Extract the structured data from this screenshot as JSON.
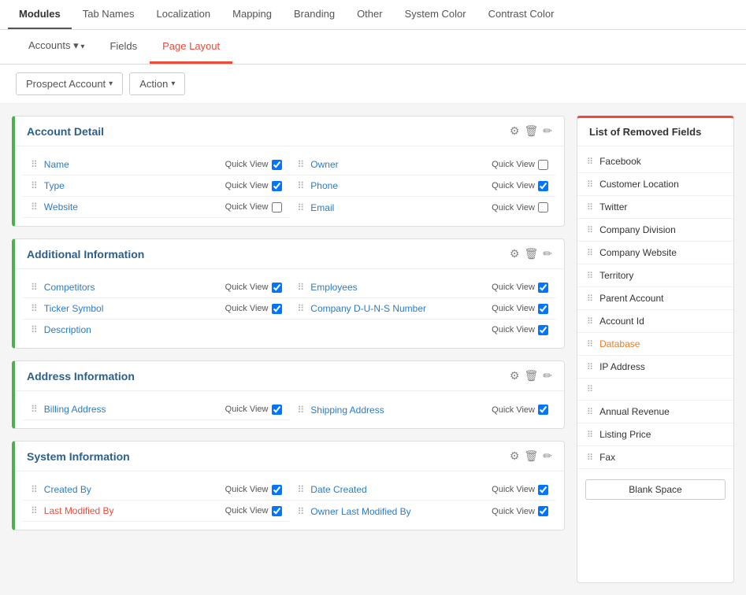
{
  "topNav": {
    "tabs": [
      {
        "id": "modules",
        "label": "Modules",
        "active": true
      },
      {
        "id": "tab-names",
        "label": "Tab Names",
        "active": false
      },
      {
        "id": "localization",
        "label": "Localization",
        "active": false
      },
      {
        "id": "mapping",
        "label": "Mapping",
        "active": false
      },
      {
        "id": "branding",
        "label": "Branding",
        "active": false
      },
      {
        "id": "other",
        "label": "Other",
        "active": false
      },
      {
        "id": "system-color",
        "label": "System Color",
        "active": false
      },
      {
        "id": "contrast-color",
        "label": "Contrast Color",
        "active": false
      }
    ]
  },
  "subNav": {
    "tabs": [
      {
        "id": "accounts",
        "label": "Accounts",
        "active": false,
        "hasArrow": true
      },
      {
        "id": "fields",
        "label": "Fields",
        "active": false,
        "hasArrow": false
      },
      {
        "id": "page-layout",
        "label": "Page Layout",
        "active": true,
        "hasArrow": false
      }
    ]
  },
  "toolbar": {
    "accountDropdown": "Prospect Account",
    "actionDropdown": "Action"
  },
  "sections": [
    {
      "id": "account-detail",
      "title": "Account Detail",
      "fields": [
        {
          "col": 0,
          "name": "Name",
          "isRed": false,
          "quickViewLabel": "Quick View",
          "checked": true
        },
        {
          "col": 1,
          "name": "Owner",
          "isRed": false,
          "quickViewLabel": "Quick View",
          "checked": false
        },
        {
          "col": 0,
          "name": "Type",
          "isRed": false,
          "quickViewLabel": "Quick View",
          "checked": true
        },
        {
          "col": 1,
          "name": "Phone",
          "isRed": false,
          "quickViewLabel": "Quick View",
          "checked": true
        },
        {
          "col": 0,
          "name": "Website",
          "isRed": false,
          "quickViewLabel": "Quick View",
          "checked": false
        },
        {
          "col": 1,
          "name": "Email",
          "isRed": false,
          "quickViewLabel": "Quick View",
          "checked": false
        }
      ]
    },
    {
      "id": "additional-information",
      "title": "Additional Information",
      "fields": [
        {
          "col": 0,
          "name": "Competitors",
          "isRed": false,
          "quickViewLabel": "Quick View",
          "checked": true
        },
        {
          "col": 1,
          "name": "Employees",
          "isRed": false,
          "quickViewLabel": "Quick View",
          "checked": true
        },
        {
          "col": 0,
          "name": "Ticker Symbol",
          "isRed": false,
          "quickViewLabel": "Quick View",
          "checked": true
        },
        {
          "col": 1,
          "name": "Company D-U-N-S Number",
          "isRed": false,
          "quickViewLabel": "Quick View",
          "checked": true
        },
        {
          "col": 0,
          "name": "Description",
          "isRed": false,
          "quickViewLabel": "Quick View",
          "checked": true,
          "fullWidth": true
        }
      ]
    },
    {
      "id": "address-information",
      "title": "Address Information",
      "fields": [
        {
          "col": 0,
          "name": "Billing Address",
          "isRed": false,
          "quickViewLabel": "Quick View",
          "checked": true
        },
        {
          "col": 1,
          "name": "Shipping Address",
          "isRed": false,
          "quickViewLabel": "Quick View",
          "checked": true
        }
      ]
    },
    {
      "id": "system-information",
      "title": "System Information",
      "fields": [
        {
          "col": 0,
          "name": "Created By",
          "isRed": false,
          "quickViewLabel": "Quick View",
          "checked": true
        },
        {
          "col": 1,
          "name": "Date Created",
          "isRed": false,
          "quickViewLabel": "Quick View",
          "checked": true
        },
        {
          "col": 0,
          "name": "Last Modified By",
          "isRed": true,
          "quickViewLabel": "Quick View",
          "checked": true
        },
        {
          "col": 1,
          "name": "Owner Last Modified By",
          "isRed": false,
          "quickViewLabel": "Quick View",
          "checked": true
        }
      ]
    }
  ],
  "removedFields": {
    "title": "List of Removed Fields",
    "items": [
      {
        "name": "Facebook",
        "isOrange": false
      },
      {
        "name": "Customer Location",
        "isOrange": false
      },
      {
        "name": "Twitter",
        "isOrange": false
      },
      {
        "name": "Company Division",
        "isOrange": false
      },
      {
        "name": "Company Website",
        "isOrange": false
      },
      {
        "name": "Territory",
        "isOrange": false
      },
      {
        "name": "Parent Account",
        "isOrange": false
      },
      {
        "name": "Account Id",
        "isOrange": false
      },
      {
        "name": "Database",
        "isOrange": true
      },
      {
        "name": "IP Address",
        "isOrange": false
      },
      {
        "name": "",
        "isOrange": false
      },
      {
        "name": "Annual Revenue",
        "isOrange": false
      },
      {
        "name": "Listing Price",
        "isOrange": false
      },
      {
        "name": "Fax",
        "isOrange": false
      }
    ],
    "blankSpaceLabel": "Blank Space"
  },
  "icons": {
    "gear": "⚙",
    "trash": "🗑",
    "edit": "✎",
    "arrowDown": "▾",
    "drag": "⠿"
  }
}
